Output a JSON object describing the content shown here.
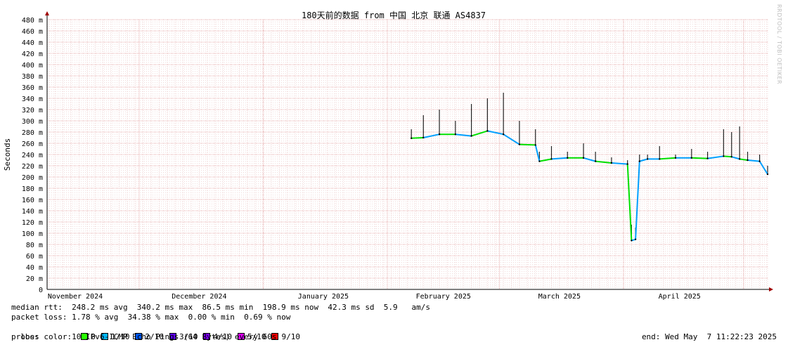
{
  "chart_data": {
    "type": "line",
    "title": "180天前的数据 from 中国 北京 联通 AS4837",
    "ylabel": "Seconds",
    "ylim": [
      0,
      0.48
    ],
    "y_tick_labels": [
      "0",
      "20 m",
      "40 m",
      "60 m",
      "80 m",
      "100 m",
      "120 m",
      "140 m",
      "160 m",
      "180 m",
      "200 m",
      "220 m",
      "240 m",
      "260 m",
      "280 m",
      "300 m",
      "320 m",
      "340 m",
      "360 m",
      "380 m",
      "400 m",
      "420 m",
      "440 m",
      "460 m",
      "480 m"
    ],
    "x_tick_labels": [
      "November 2024",
      "December 2024",
      "January 2025",
      "February 2025",
      "March 2025",
      "April 2025"
    ],
    "x_range": [
      "2024-11-08",
      "2025-05-07"
    ],
    "grid": true,
    "series": [
      {
        "x": [
          "2025-02-07",
          "2025-02-10",
          "2025-02-14",
          "2025-02-18",
          "2025-02-22",
          "2025-02-26",
          "2025-03-02",
          "2025-03-06",
          "2025-03-10",
          "2025-03-11",
          "2025-03-14",
          "2025-03-18",
          "2025-03-22",
          "2025-03-25",
          "2025-03-29",
          "2025-04-02",
          "2025-04-03",
          "2025-04-04",
          "2025-04-05",
          "2025-04-07",
          "2025-04-10",
          "2025-04-14",
          "2025-04-18",
          "2025-04-22",
          "2025-04-26",
          "2025-04-28",
          "2025-04-30",
          "2025-05-02",
          "2025-05-05",
          "2025-05-07"
        ],
        "median_rtt_s": [
          0.269,
          0.27,
          0.276,
          0.276,
          0.273,
          0.282,
          0.276,
          0.258,
          0.257,
          0.228,
          0.232,
          0.234,
          0.234,
          0.228,
          0.225,
          0.223,
          0.087,
          0.089,
          0.228,
          0.232,
          0.232,
          0.234,
          0.234,
          0.233,
          0.237,
          0.236,
          0.232,
          0.23,
          0.228,
          0.205
        ],
        "max_rtt_s": [
          0.285,
          0.31,
          0.32,
          0.3,
          0.33,
          0.34,
          0.35,
          0.3,
          0.285,
          0.245,
          0.255,
          0.245,
          0.26,
          0.245,
          0.235,
          0.23,
          0.115,
          0.11,
          0.24,
          0.24,
          0.255,
          0.24,
          0.25,
          0.245,
          0.285,
          0.28,
          0.29,
          0.245,
          0.24,
          0.22
        ],
        "loss_color": [
          "#00e000",
          "#00a0ff",
          "#00e000",
          "#00a0ff",
          "#00e000",
          "#00a0ff",
          "#00a0ff",
          "#00e000",
          "#00a0ff",
          "#00e000",
          "#00a0ff",
          "#00e000",
          "#00a0ff",
          "#00e000",
          "#00a0ff",
          "#00e000",
          "#00a0ff",
          "#00a0ff",
          "#00a0ff",
          "#00a0ff",
          "#00e000",
          "#00a0ff",
          "#00e000",
          "#00a0ff",
          "#00e000",
          "#00a0ff",
          "#00e000",
          "#00a0ff",
          "#00a0ff",
          "#00a0ff"
        ]
      }
    ]
  },
  "stats": {
    "median_rtt": "median rtt:  248.2 ms avg  340.2 ms max  86.5 ms min  198.9 ms now  42.3 ms sd  5.9   am/s",
    "packet_loss": "packet loss: 1.78 % avg  34.38 % max  0.00 % min  0.69 % now",
    "loss_color_label": "loss color:",
    "loss_colors": [
      {
        "label": "0",
        "color": "#26ff00"
      },
      {
        "label": "1/10",
        "color": "#00b8ff"
      },
      {
        "label": "2/10",
        "color": "#0059ff"
      },
      {
        "label": "3/10",
        "color": "#5e00ff"
      },
      {
        "label": "4/10",
        "color": "#7e00ff"
      },
      {
        "label": "5/10",
        "color": "#dd00ff"
      },
      {
        "label": "9/10",
        "color": "#ff0000"
      }
    ],
    "probe": "probe:       10 IPv6-ICMP Echo Pings (64 Bytes) every 60s",
    "end": "end: Wed May  7 11:22:23 2025"
  },
  "credit": "RRDTOOL / TOBI OETIKER"
}
